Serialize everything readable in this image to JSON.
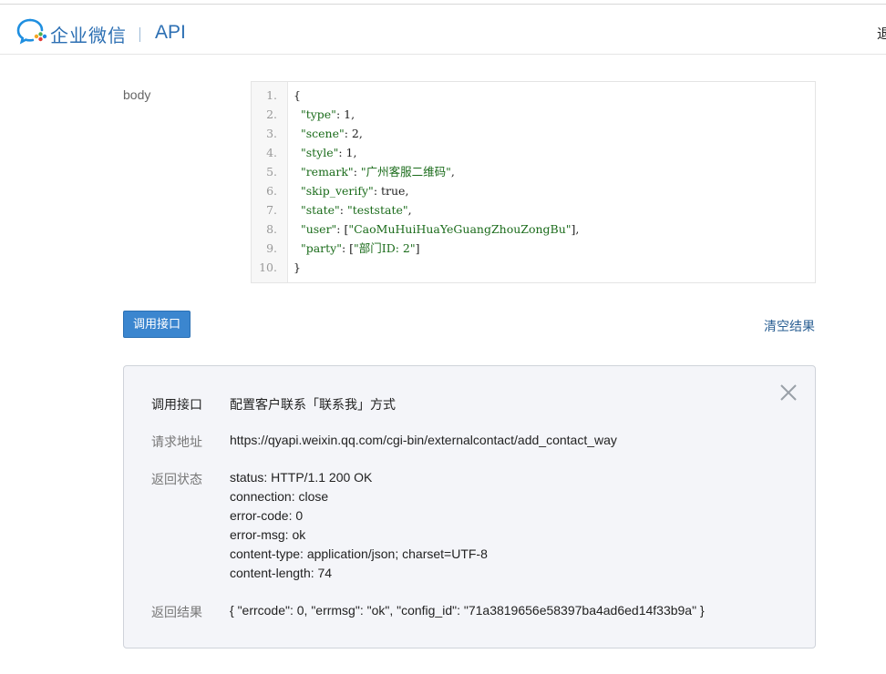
{
  "header": {
    "brand": "企业微信",
    "section": "API",
    "right_text": "退"
  },
  "request": {
    "body_label": "body",
    "code_lines": [
      {
        "n": "1.",
        "text": "{"
      },
      {
        "n": "2.",
        "text": "  \"type\": 1,"
      },
      {
        "n": "3.",
        "text": "  \"scene\": 2,"
      },
      {
        "n": "4.",
        "text": "  \"style\": 1,"
      },
      {
        "n": "5.",
        "text": "  \"remark\": \"广州客服二维码\","
      },
      {
        "n": "6.",
        "text": "  \"skip_verify\": true,"
      },
      {
        "n": "7.",
        "text": "  \"state\": \"teststate\","
      },
      {
        "n": "8.",
        "text": "  \"user\": [\"CaoMuHuiHuaYeGuangZhouZongBu\"],"
      },
      {
        "n": "9.",
        "text": "  \"party\": [\"部门ID: 2\"]"
      },
      {
        "n": "10.",
        "text": "}"
      }
    ]
  },
  "actions": {
    "call_label": "调用接口",
    "clear_label": "清空结果"
  },
  "result": {
    "api_label": "调用接口",
    "api_value": "配置客户联系「联系我」方式",
    "url_label": "请求地址",
    "url_value": "https://qyapi.weixin.qq.com/cgi-bin/externalcontact/add_contact_way",
    "status_label": "返回状态",
    "status_lines": [
      "status: HTTP/1.1 200 OK",
      "connection: close",
      "error-code: 0",
      "error-msg: ok",
      "content-type: application/json; charset=UTF-8",
      "content-length: 74"
    ],
    "result_label": "返回结果",
    "result_value": "{ \"errcode\": 0, \"errmsg\": \"ok\", \"config_id\": \"71a3819656e58397ba4ad6ed14f33b9a\" }"
  },
  "icons": {
    "logo": "wecom-logo-icon",
    "close": "close-icon"
  },
  "colors": {
    "brand": "#2c6fb3",
    "button": "#3b86cf",
    "link": "#2a5f93",
    "string": "#1a6b1a"
  }
}
